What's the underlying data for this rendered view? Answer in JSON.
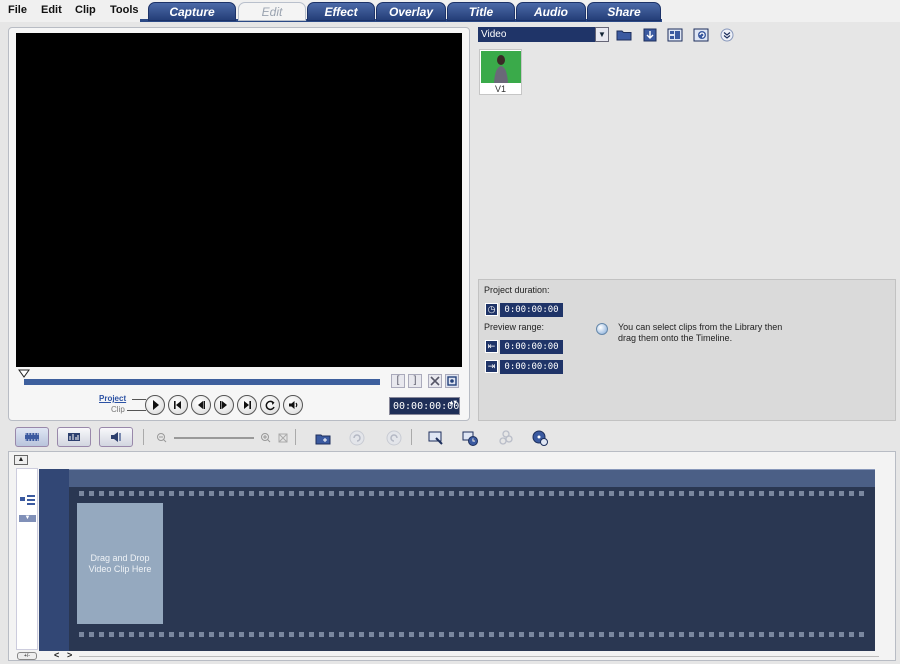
{
  "menu": [
    "File",
    "Edit",
    "Clip",
    "Tools"
  ],
  "tabs": [
    {
      "label": "Capture",
      "active": false
    },
    {
      "label": "Edit",
      "active": true
    },
    {
      "label": "Effect",
      "active": false
    },
    {
      "label": "Overlay",
      "active": false
    },
    {
      "label": "Title",
      "active": false
    },
    {
      "label": "Audio",
      "active": false
    },
    {
      "label": "Share",
      "active": false
    }
  ],
  "preview": {
    "mode_project": "Project",
    "mode_clip": "Clip",
    "mark_in": "[",
    "mark_out": "]",
    "timecode": "00:00:00:00",
    "spin": "▲▼",
    "icons": {
      "marker": "scrub-marker-icon",
      "cut": "scissors-icon",
      "fullscreen": "fullscreen-icon",
      "play": "play-icon",
      "home": "go-to-start-icon",
      "prev": "previous-frame-icon",
      "next": "next-frame-icon",
      "end": "go-to-end-icon",
      "repeat": "repeat-icon",
      "volume": "volume-icon"
    }
  },
  "library": {
    "dropdown_value": "Video",
    "dropdown_arrow": "▼",
    "thumbnail_label": "V1",
    "thumbnail_color": "#3aaa4a"
  },
  "project_info": {
    "duration_label": "Project duration:",
    "duration": "0:00:00:00",
    "preview_range_label": "Preview range:",
    "range_start": "0:00:00:00",
    "range_end": "0:00:00:00",
    "hint": "You can select clips from the Library then drag them onto the Timeline."
  },
  "timeline": {
    "drop_zone_text": "Drag and Drop Video Clip Here",
    "eject": "▲",
    "expand": "▼",
    "ruler_marker": "▲",
    "zoom_btn": "+/-",
    "scroll_left": "<",
    "scroll_right": ">"
  },
  "colors": {
    "tab_blue": "#2c4a86",
    "timecode_bg": "#1f3468",
    "timeline_bg": "#2a3752",
    "drop_zone": "#95a9bf"
  }
}
